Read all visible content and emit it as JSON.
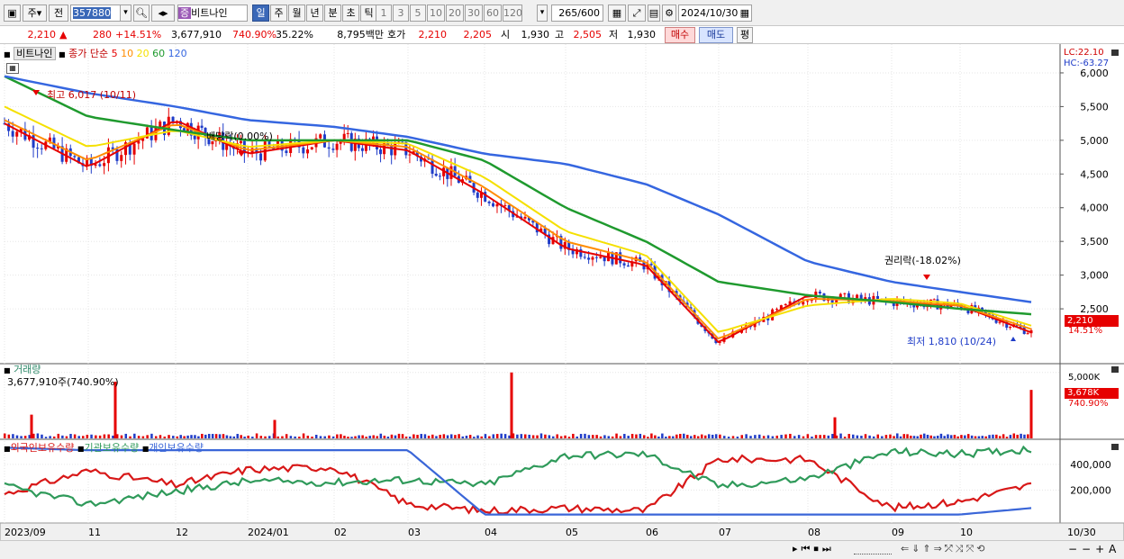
{
  "toolbar": {
    "market": "주",
    "period_prev": "전",
    "code": "357880",
    "badge": "증",
    "name": "비트나인",
    "periods": [
      "일",
      "주",
      "월",
      "년",
      "분",
      "초",
      "틱"
    ],
    "selected_period": "일",
    "intervals": [
      "1",
      "3",
      "5",
      "10",
      "20",
      "30",
      "60",
      "120"
    ],
    "count_current": "265",
    "count_total": "/600",
    "date": "2024/10/30"
  },
  "info": {
    "price": "2,210",
    "change": "280",
    "change_pct": "+14.51%",
    "volume": "3,677,910",
    "volume_ratio": "740.90%",
    "turnover": "35.22%",
    "amount": "8,795백만",
    "quote_label": "호가",
    "ask": "2,210",
    "bid": "2,205",
    "open_label": "시",
    "open": "1,930",
    "high_label": "고",
    "high": "2,505",
    "low_label": "저",
    "low": "1,930",
    "buy_btn": "매수",
    "sell_btn": "매도",
    "eval_btn": "평"
  },
  "price_pane": {
    "name_label": "비트나인",
    "ma_title": "종가 단순",
    "ma_periods": [
      "5",
      "10",
      "20",
      "60",
      "120"
    ],
    "lc": "LC:22.10",
    "hc": "HC:-63.27",
    "current_price_tag": "2,210",
    "current_pct_tag": "14.51%",
    "y_ticks": [
      "6,000",
      "5,500",
      "5,000",
      "4,500",
      "4,000",
      "3,500",
      "3,000",
      "2,500"
    ],
    "annot_high": "최고 6,017 (10/11)",
    "annot_div": "배당락(0.00%)",
    "annot_rights": "권리락(-18.02%)",
    "annot_low": "최저 1,810 (10/24)"
  },
  "volume_pane": {
    "title": "거래량",
    "value": "3,677,910주(740.90%)",
    "y_tick": "5,000K",
    "tag": "3,678K",
    "tag_pct": "740.90%"
  },
  "holding_pane": {
    "legend": [
      "외국인보유수량",
      "기관보유수량",
      "개인보유수량"
    ],
    "y_ticks": [
      "400,000",
      "200,000"
    ]
  },
  "x_axis": {
    "labels": [
      "2023/09",
      "11",
      "12",
      "2024/01",
      "02",
      "03",
      "04",
      "05",
      "06",
      "07",
      "08",
      "09",
      "10"
    ],
    "end_label": "10/30"
  },
  "colors": {
    "up": "#e60000",
    "down": "#1f3cc8",
    "ma5": "#e60000",
    "ma10": "#ff8c00",
    "ma20": "#f5e000",
    "ma60": "#1f9a2e",
    "ma120": "#3566e0",
    "foreign": "#d81818",
    "institution": "#2f9a5a",
    "individual": "#3a66d8"
  },
  "chart_data": [
    {
      "type": "line",
      "title": "비트나인",
      "x": [
        "2023/09",
        "11",
        "12",
        "2024/01",
        "02",
        "03",
        "04",
        "05",
        "06",
        "07",
        "08",
        "09",
        "10",
        "10/30"
      ],
      "series": [
        {
          "name": "5",
          "values": [
            5250,
            4600,
            5300,
            4800,
            5000,
            4850,
            4200,
            3400,
            3150,
            2000,
            2700,
            2600,
            2550,
            2150
          ]
        },
        {
          "name": "10",
          "values": [
            5300,
            4700,
            5250,
            4850,
            5000,
            4900,
            4300,
            3500,
            3200,
            2050,
            2650,
            2620,
            2550,
            2200
          ]
        },
        {
          "name": "20",
          "values": [
            5500,
            4900,
            5150,
            4900,
            5000,
            4950,
            4450,
            3650,
            3300,
            2150,
            2550,
            2650,
            2580,
            2250
          ]
        },
        {
          "name": "60",
          "values": [
            5950,
            5350,
            5150,
            5000,
            5000,
            5000,
            4700,
            4000,
            3500,
            2900,
            2700,
            2600,
            2500,
            2420
          ]
        },
        {
          "name": "120",
          "values": [
            5950,
            5700,
            5500,
            5300,
            5200,
            5050,
            4800,
            4650,
            4350,
            3900,
            3200,
            2900,
            2750,
            2600
          ]
        }
      ],
      "ylim": [
        1700,
        6400
      ]
    },
    {
      "type": "bar",
      "title": "거래량",
      "categories": [
        "2023/09",
        "11",
        "12",
        "2024/01",
        "02",
        "03",
        "04",
        "05",
        "06",
        "07",
        "08",
        "09",
        "10",
        "10/30"
      ],
      "values": [
        1800,
        4300,
        400,
        1400,
        300,
        200,
        5000,
        500,
        300,
        700,
        1600,
        400,
        300,
        3678
      ],
      "ylim": [
        0,
        5600
      ]
    },
    {
      "type": "line",
      "x": [
        "2023/09",
        "11",
        "12",
        "2024/01",
        "02",
        "03",
        "04",
        "05",
        "06",
        "07",
        "08",
        "09",
        "10",
        "10/30"
      ],
      "series": [
        {
          "name": "외국인보유수량",
          "values": [
            170000,
            350000,
            240000,
            360000,
            380000,
            90000,
            40000,
            60000,
            40000,
            440000,
            440000,
            60000,
            110000,
            240000
          ]
        },
        {
          "name": "기관보유수량",
          "values": [
            230000,
            90000,
            190000,
            270000,
            260000,
            280000,
            240000,
            470000,
            480000,
            230000,
            290000,
            500000,
            480000,
            520000
          ]
        },
        {
          "name": "개인보유수량",
          "values": [
            530000,
            510000,
            510000,
            510000,
            510000,
            510000,
            10000,
            10000,
            10000,
            10000,
            10000,
            10000,
            10000,
            60000
          ]
        }
      ],
      "ylim": [
        0,
        560000
      ]
    }
  ]
}
